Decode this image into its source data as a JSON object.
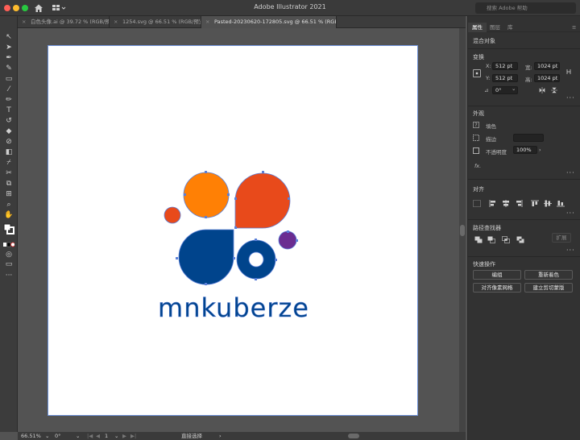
{
  "window": {
    "title": "Adobe Illustrator 2021",
    "search_placeholder": "搜索 Adobe 帮助"
  },
  "tabs": [
    {
      "label": "白色头像.ai @ 39.72 % (RGB/预览)"
    },
    {
      "label": "1254.svg @ 66.51 % (RGB/预览)"
    },
    {
      "label": "Pasted-20230620-172805.svg @ 66.51 % (RGB/预览)"
    }
  ],
  "status": {
    "zoom": "66.51%",
    "angle": "0°",
    "artboard": "1",
    "tool": "直接选择"
  },
  "artwork": {
    "wordmark": "mnkuberze",
    "colors": {
      "orange": "#ff8005",
      "red": "#e84a1b",
      "blue": "#00448c",
      "purple": "#6a2d91",
      "selection": "#5a7fd8"
    }
  },
  "panel": {
    "tabs": [
      "属性",
      "图层",
      "库"
    ],
    "object_type": "混合对象",
    "transform": {
      "title": "变换",
      "x_label": "X:",
      "x": "512 pt",
      "y_label": "Y:",
      "y": "512 pt",
      "w_label": "宽:",
      "w": "1024 pt",
      "h_label": "高:",
      "h": "1024 pt",
      "angle": "0°"
    },
    "appearance": {
      "title": "外观",
      "fill": "填色",
      "stroke": "描边",
      "opacity_label": "不透明度",
      "opacity": "100%",
      "fx": "fx."
    },
    "align": {
      "title": "对齐"
    },
    "pathfinder": {
      "title": "路径查找器",
      "expand": "扩展"
    },
    "quick_actions": {
      "title": "快速操作",
      "group": "编组",
      "recolor": "重新着色",
      "align_pixel": "对齐像素网格",
      "clip_mask": "建立剪切蒙版"
    }
  }
}
